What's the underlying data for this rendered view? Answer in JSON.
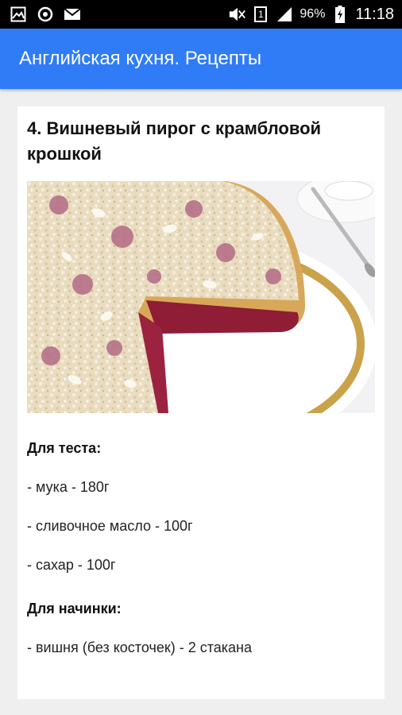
{
  "status_bar": {
    "icons_left": [
      "image-icon",
      "sync-icon",
      "mail-icon"
    ],
    "icons_right": [
      "mute-icon",
      "sim-icon",
      "signal-icon",
      "battery-icon"
    ],
    "sim_number": "1",
    "battery": "96%",
    "time": "11:18"
  },
  "app_bar": {
    "title": "Английская кухня. Рецепты",
    "color": "#2f7cf6"
  },
  "recipe": {
    "title": "4. Вишневый пирог с крамбловой крошкой",
    "image": "cherry-crumble-pie-photo",
    "sections": [
      {
        "title": "Для теста:",
        "items": [
          "- мука - 180г",
          "- сливочное масло - 100г",
          "- сахар - 100г"
        ]
      },
      {
        "title": "Для начинки:",
        "items": [
          "- вишня (без косточек) - 2 стакана"
        ]
      }
    ]
  }
}
